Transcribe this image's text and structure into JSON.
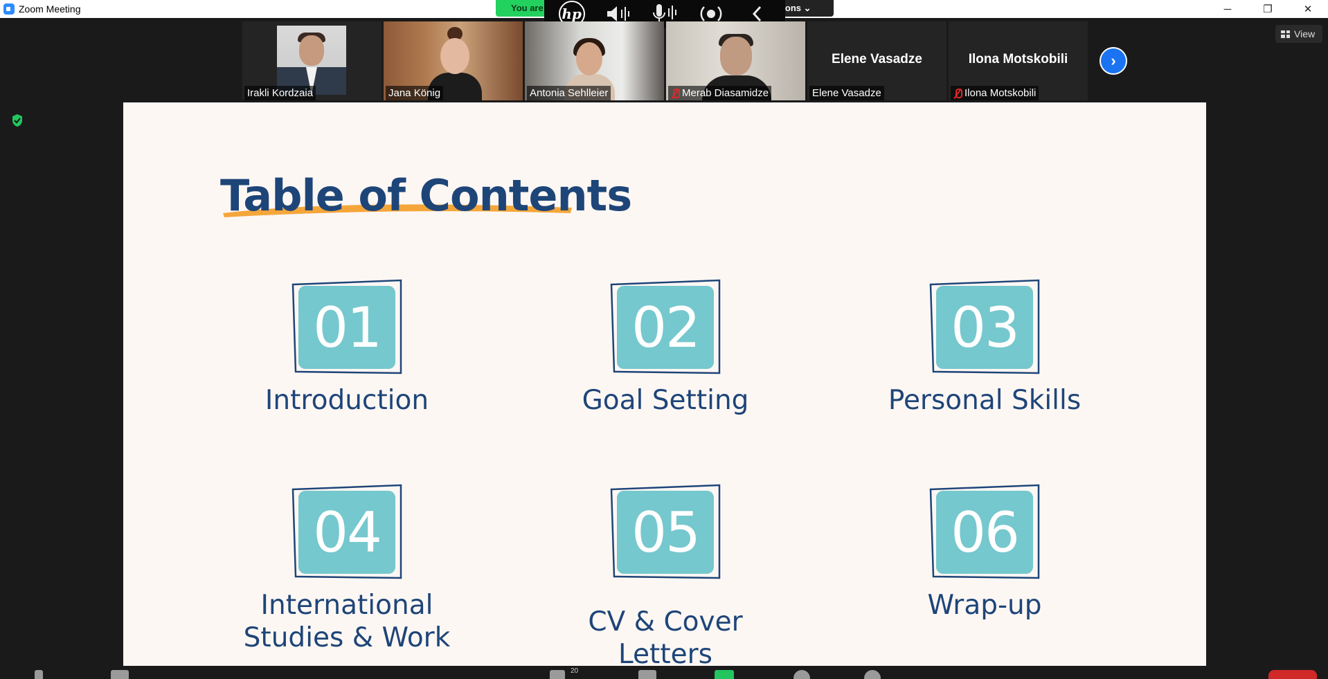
{
  "window": {
    "title": "Zoom Meeting",
    "controls": {
      "minimize": "─",
      "restore": "❐",
      "close": "✕"
    }
  },
  "notice": {
    "text": "You are"
  },
  "captions": {
    "label": "ptions ⌄"
  },
  "hp_toolbar": {
    "logo": "hp",
    "icons": [
      "speaker-icon",
      "microphone-icon",
      "broadcast-icon",
      "chevron-left-icon"
    ]
  },
  "participants": [
    {
      "name": "Irakli Kordzaia",
      "muted": false,
      "video": "photo"
    },
    {
      "name": "Jana König",
      "muted": false,
      "video": "camera"
    },
    {
      "name": "Antonia Sehlleier",
      "muted": false,
      "video": "camera",
      "active_speaker": true
    },
    {
      "name": "Merab Diasamidze",
      "muted": true,
      "video": "camera"
    },
    {
      "name": "Elene Vasadze",
      "muted": false,
      "video": "off"
    },
    {
      "name": "Ilona Motskobili",
      "muted": true,
      "video": "off"
    }
  ],
  "view_button": {
    "label": "View"
  },
  "slide": {
    "title": "Table of Contents",
    "items": [
      {
        "number": "01",
        "label": "Introduction"
      },
      {
        "number": "02",
        "label": "Goal Setting"
      },
      {
        "number": "03",
        "label": "Personal Skills"
      },
      {
        "number": "04",
        "label_line1": "International",
        "label_line2": "Studies & Work"
      },
      {
        "number": "05",
        "label": "CV & Cover Letters"
      },
      {
        "number": "06",
        "label": "Wrap-up"
      }
    ]
  },
  "footer": {
    "participant_count": "20"
  },
  "colors": {
    "accent_blue": "#1e4578",
    "teal": "#75c8cd",
    "underline_orange": "#f5a63a",
    "zoom_blue": "#1a73f0",
    "notice_green": "#23d15f"
  }
}
